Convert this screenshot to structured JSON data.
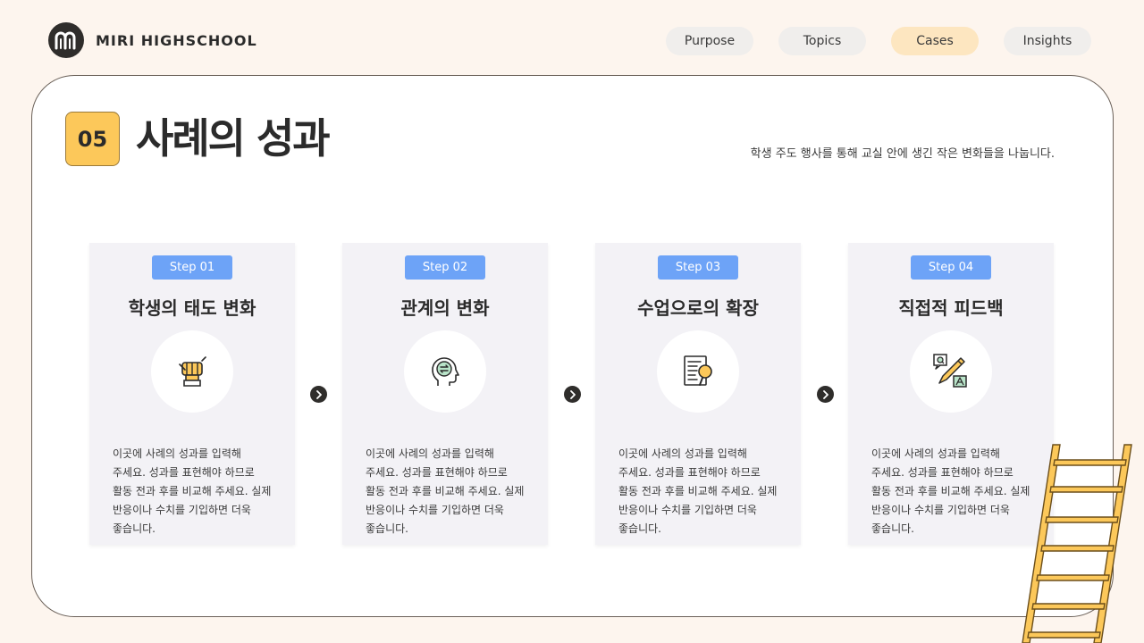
{
  "brand": {
    "name": "MIRI HIGHSCHOOL",
    "logo_icon": "m-logo-icon"
  },
  "nav": [
    {
      "label": "Purpose",
      "active": false
    },
    {
      "label": "Topics",
      "active": false
    },
    {
      "label": "Cases",
      "active": true
    },
    {
      "label": "Insights",
      "active": false
    }
  ],
  "section": {
    "number": "05",
    "title": "사례의 성과",
    "subtitle": "학생 주도 행사를 통해 교실 안에 생긴 작은 변화들을 나눕니다."
  },
  "steps": [
    {
      "badge": "Step 01",
      "title": "학생의 태도 변화",
      "icon": "raised-fist-icon",
      "desc": "이곳에 사례의 성과를 입력해 주세요. 성과를 표현해야 하므로 활동 전과 후를 비교해 주세요. 실제 반응이나 수치를 기입하면 더욱 좋습니다."
    },
    {
      "badge": "Step 02",
      "title": "관계의 변화",
      "icon": "head-exchange-icon",
      "desc": "이곳에 사례의 성과를 입력해 주세요. 성과를 표현해야 하므로 활동 전과 후를 비교해 주세요. 실제 반응이나 수치를 기입하면 더욱 좋습니다."
    },
    {
      "badge": "Step 03",
      "title": "수업으로의 확장",
      "icon": "document-search-icon",
      "desc": "이곳에 사례의 성과를 입력해 주세요. 성과를 표현해야 하므로 활동 전과 후를 비교해 주세요. 실제 반응이나 수치를 기입하면 더욱 좋습니다."
    },
    {
      "badge": "Step 04",
      "title": "직접적 피드백",
      "icon": "qa-pencil-icon",
      "desc": "이곳에 사례의 성과를 입력해 주세요. 성과를 표현해야 하므로 활동 전과 후를 비교해 주세요. 실제 반응이나 수치를 기입하면 더욱 좋습니다."
    }
  ],
  "colors": {
    "background": "#fdf5ee",
    "accent_yellow": "#fcc85a",
    "step_badge_blue": "#6da3f7",
    "nav_active": "#fde6c0",
    "icon_green": "#b9e4c9"
  }
}
